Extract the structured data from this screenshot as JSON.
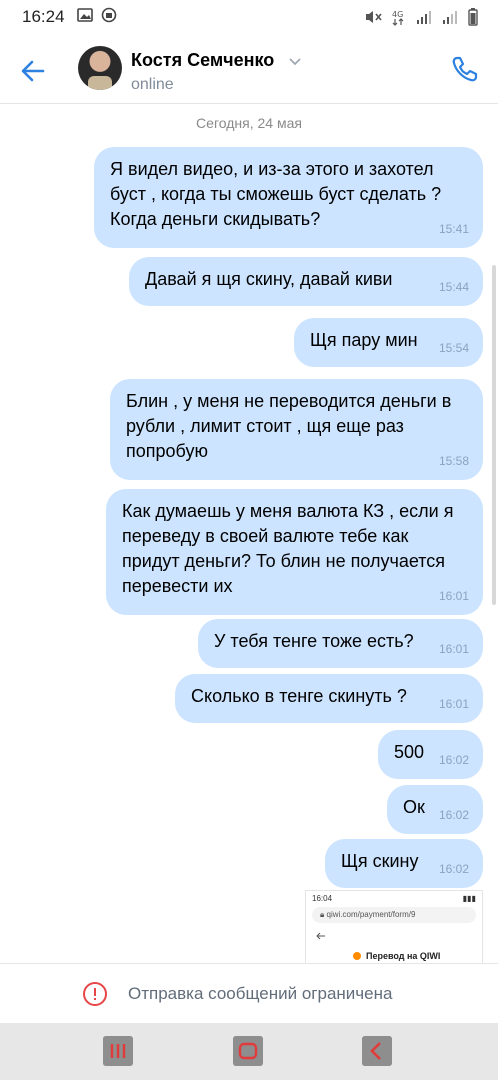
{
  "status_bar": {
    "time": "16:24"
  },
  "header": {
    "contact_name": "Костя Семченко",
    "contact_status": "online"
  },
  "chat": {
    "date_separator": "Сегодня, 24 мая",
    "messages": [
      {
        "text": "Я видел видео, и из-за этого и захотел буст , когда ты сможешь буст сделать ? Когда деньги скидывать?",
        "time": "15:41"
      },
      {
        "text": "Давай  я щя скину,  давай киви",
        "time": "15:44"
      },
      {
        "text": "Щя пару мин",
        "time": "15:54"
      },
      {
        "text": "Блин ,  у меня не переводится  деньги в рубли , лимит стоит , щя еще раз попробую",
        "time": "15:58"
      },
      {
        "text": "Как думаешь у меня валюта КЗ , если я переведу в своей валюте тебе как придут деньги? То блин не получается перевести их",
        "time": "16:01"
      },
      {
        "text": "У тебя тенге тоже есть?",
        "time": "16:01"
      },
      {
        "text": "Сколько в тенге скинуть ?",
        "time": "16:01"
      },
      {
        "text": "500",
        "time": "16:02"
      },
      {
        "text": "Ок",
        "time": "16:02"
      },
      {
        "text": "Щя скину",
        "time": "16:02"
      }
    ],
    "attachment": {
      "time": "16:04",
      "url": "qiwi.com/payment/form/9",
      "title": "Перевод на QIWI"
    }
  },
  "footer": {
    "restricted_text": "Отправка сообщений ограничена"
  },
  "colors": {
    "accent": "#2d81e0",
    "bubble": "#cce4ff",
    "warning": "#e64646"
  }
}
